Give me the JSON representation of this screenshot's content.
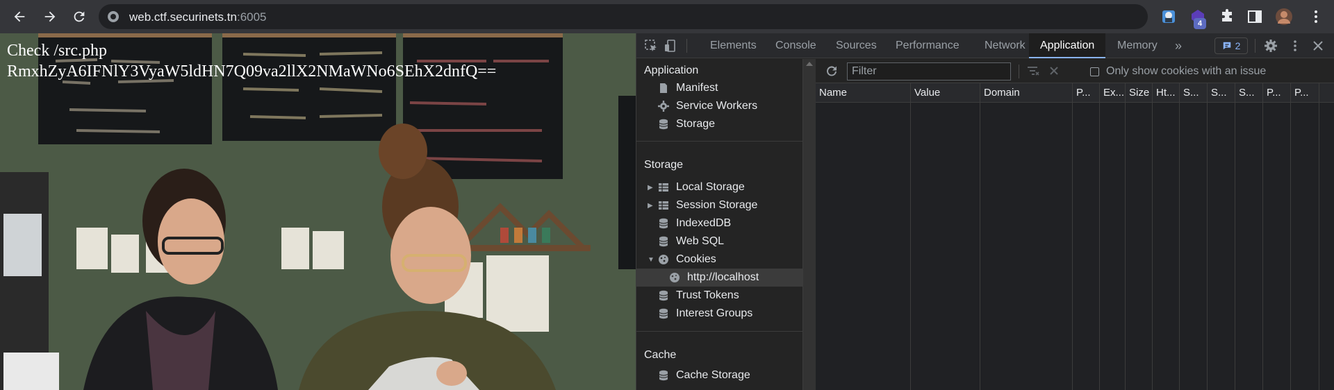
{
  "browser": {
    "url_host": "web.ctf.securinets.tn",
    "url_port": ":6005",
    "extension_badge": "4"
  },
  "page": {
    "line1": "Check /src.php",
    "line2": "RmxhZyA6IFNlY3VyaW5ldHN7Q09va2llX2NMaWNo6SEhX2dnfQ=="
  },
  "devtools": {
    "tabs": [
      "Elements",
      "Console",
      "Sources",
      "Performance",
      "Network",
      "Application",
      "Memory"
    ],
    "active_tab": "Application",
    "more_tabs": "»",
    "issues_count": "2",
    "sidebar": {
      "application_title": "Application",
      "application_items": [
        "Manifest",
        "Service Workers",
        "Storage"
      ],
      "storage_title": "Storage",
      "storage_items": [
        "Local Storage",
        "Session Storage",
        "IndexedDB",
        "Web SQL",
        "Cookies"
      ],
      "cookie_origin": "http://localhost",
      "storage_items_2": [
        "Trust Tokens",
        "Interest Groups"
      ],
      "cache_title": "Cache",
      "cache_items": [
        "Cache Storage"
      ]
    },
    "cookies": {
      "filter_placeholder": "Filter",
      "only_issues_label": "Only show cookies with an issue",
      "columns": [
        "Name",
        "Value",
        "Domain",
        "P...",
        "Ex...",
        "Size",
        "Ht...",
        "S...",
        "S...",
        "S...",
        "P...",
        "P..."
      ]
    }
  }
}
